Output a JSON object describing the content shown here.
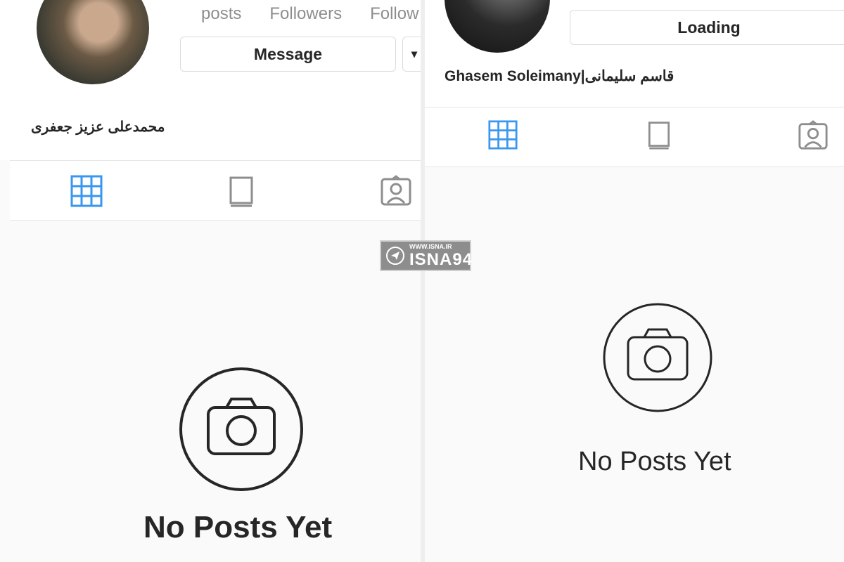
{
  "left_profile": {
    "stats": {
      "posts_label": "posts",
      "followers_label": "Followers",
      "following_label": "Follow"
    },
    "message_button": "Message",
    "more_button": "▾",
    "display_name": "محمدعلی عزیز جعفری",
    "tabs": [
      "grid-icon",
      "igtv-icon",
      "tagged-icon"
    ],
    "empty_text": "No Posts Yet"
  },
  "right_profile": {
    "loading_button": "Loading",
    "display_name": "Ghasem Soleimany|قاسم سلیمانی",
    "tabs": [
      "grid-icon",
      "igtv-icon",
      "tagged-icon"
    ],
    "empty_text": "No Posts Yet"
  },
  "watermark": {
    "url": "WWW.ISNA.IR",
    "logo": "ISNA94"
  },
  "colors": {
    "active_tab": "#3897f0",
    "inactive_tab": "#8e8e8e",
    "text": "#262626"
  }
}
